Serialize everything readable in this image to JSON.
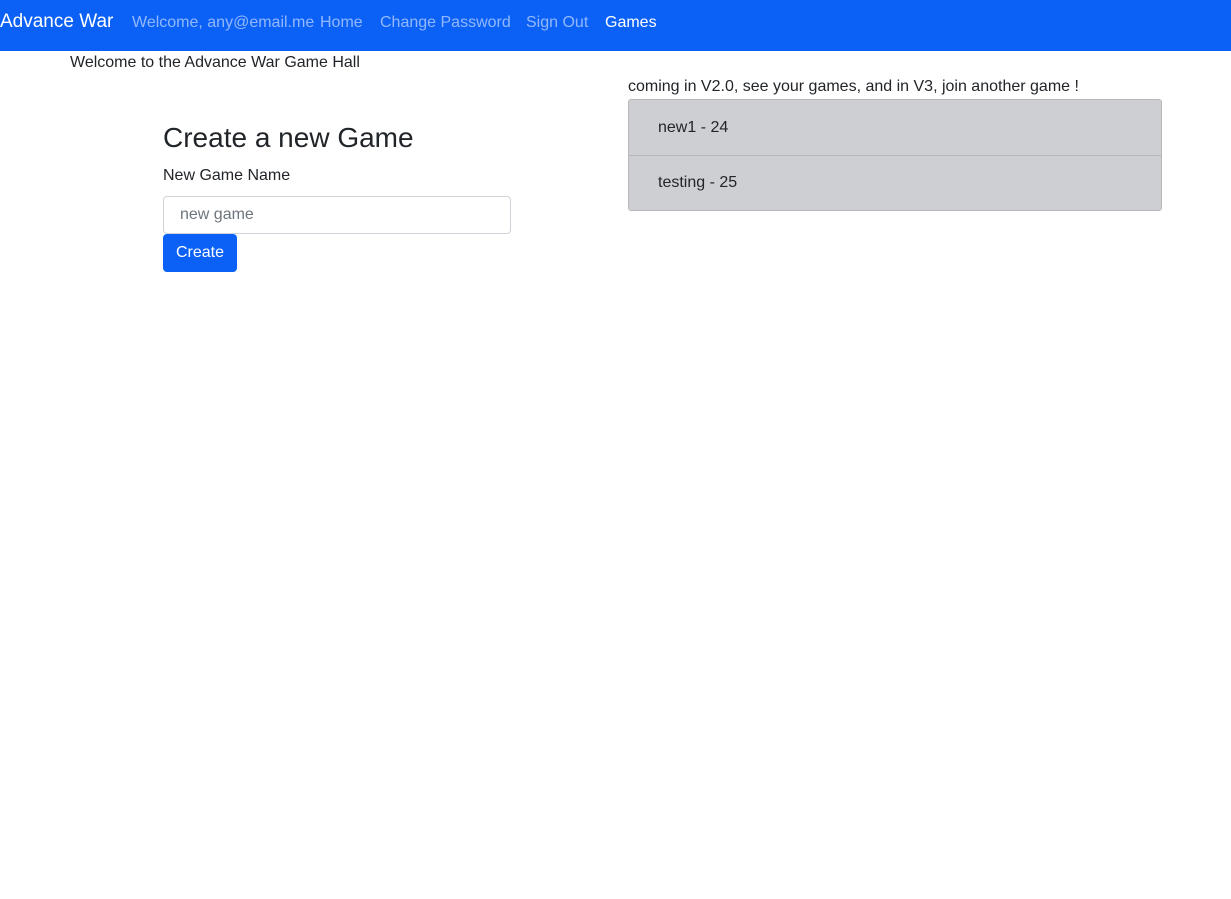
{
  "navbar": {
    "brand": "Advance War",
    "welcome": "Welcome, any@email.me",
    "links": {
      "home": "Home",
      "change_password": "Change Password",
      "sign_out": "Sign Out",
      "games": "Games"
    },
    "active_link": "Games",
    "colors": {
      "background": "#0b61f6",
      "text": "#ffffff"
    }
  },
  "main": {
    "hall_welcome": "Welcome to the Advance War Game Hall",
    "coming_note": "coming in V2.0, see your games, and in V3, join another game !",
    "create_form": {
      "title": "Create a new Game",
      "label": "New Game Name",
      "input_value": "",
      "input_placeholder": "new game",
      "submit_label": "Create"
    },
    "games": [
      {
        "label": "new1 - 24"
      },
      {
        "label": "testing - 25"
      }
    ]
  },
  "colors": {
    "primary": "#0b61f6",
    "list_item_bg": "#cecfd2"
  }
}
